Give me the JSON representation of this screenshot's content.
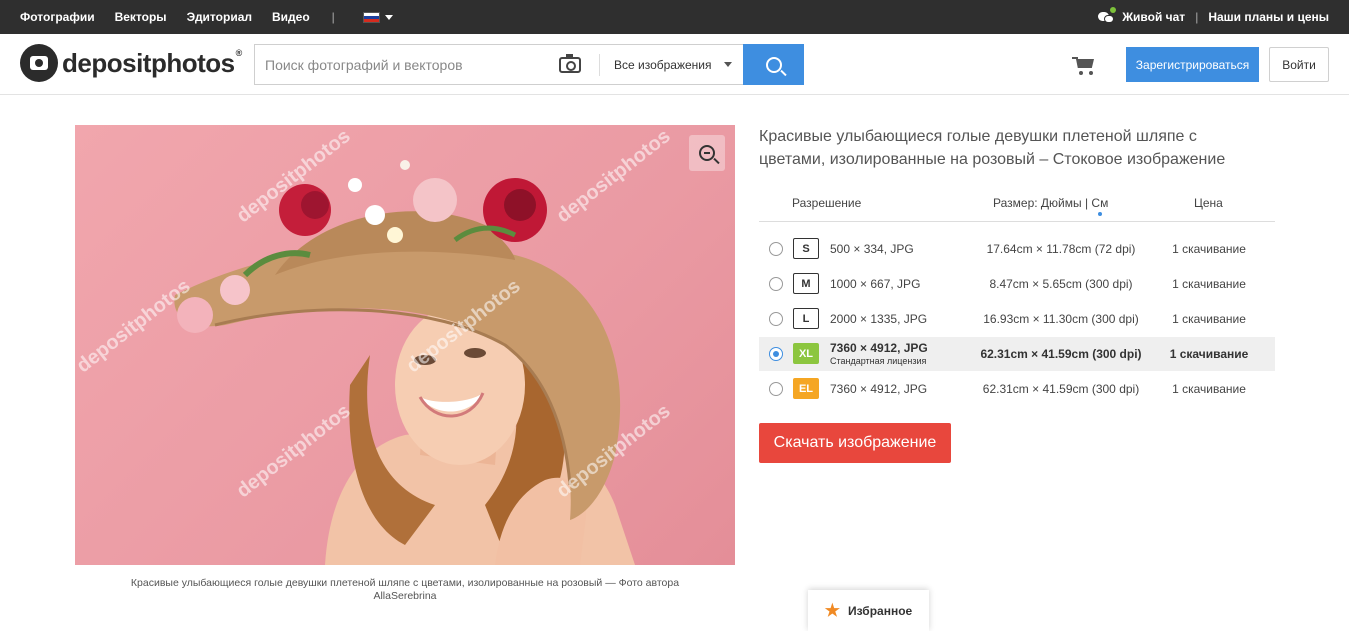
{
  "topbar": {
    "nav": [
      "Фотографии",
      "Векторы",
      "Эдиториал",
      "Видео"
    ],
    "live_chat": "Живой чат",
    "plans": "Наши планы и цены"
  },
  "header": {
    "logo_text": "depositphotos",
    "logo_reg": "®",
    "search_placeholder": "Поиск фотографий и векторов",
    "filter": "Все изображения",
    "register": "Зарегистрироваться",
    "login": "Войти"
  },
  "photo": {
    "watermark": "depositphotos",
    "caption_line1": "Красивые улыбающиеся голые девушки плетеной шляпе с цветами, изолированные на розовый — Фото автора",
    "caption_line2": "AllaSerebrina"
  },
  "product": {
    "title_line1": "Красивые улыбающиеся голые девушки плетеной шляпе с",
    "title_line2": "цветами, изолированные на розовый  –   Стоковое изображение"
  },
  "table": {
    "headers": {
      "resolution": "Разрешение",
      "size": "Размер: Дюймы | См",
      "price": "Цена"
    },
    "rows": [
      {
        "badge": "S",
        "resolution": "500 × 334, JPG",
        "size": "17.64cm × 11.78cm (72 dpi)",
        "price": "1 скачивание"
      },
      {
        "badge": "M",
        "resolution": "1000 × 667, JPG",
        "size": "8.47cm × 5.65cm (300 dpi)",
        "price": "1 скачивание"
      },
      {
        "badge": "L",
        "resolution": "2000 × 1335, JPG",
        "size": "16.93cm × 11.30cm (300 dpi)",
        "price": "1 скачивание"
      },
      {
        "badge": "XL",
        "resolution": "7360 × 4912, JPG",
        "license": "Стандартная лицензия",
        "size": "62.31cm × 41.59cm (300 dpi)",
        "price": "1 скачивание",
        "selected": true
      },
      {
        "badge": "EL",
        "resolution": "7360 × 4912, JPG",
        "size": "62.31cm × 41.59cm (300 dpi)",
        "price": "1 скачивание"
      }
    ]
  },
  "download_button": "Скачать изображение",
  "favorites": "Избранное",
  "colors": {
    "accent_blue": "#3e8ee0",
    "download_red": "#e8473d",
    "badge_xl": "#8cc63f",
    "badge_el": "#f5a623",
    "topbar": "#2f2f2f"
  }
}
